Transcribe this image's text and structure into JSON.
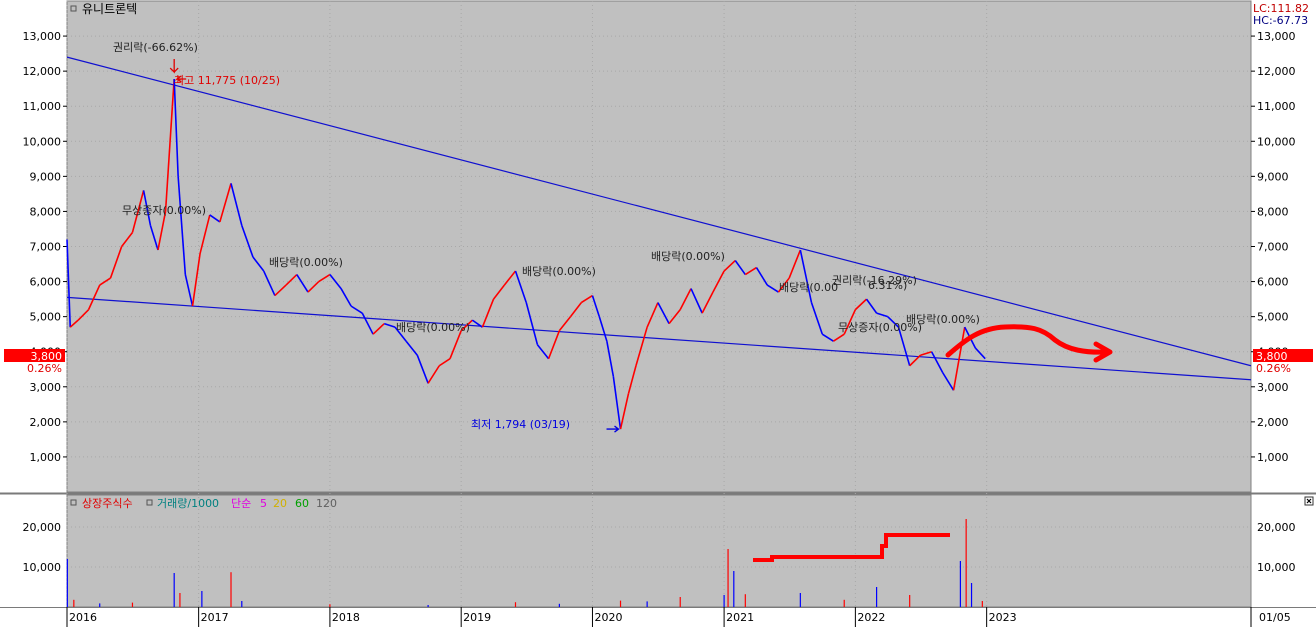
{
  "instrument": {
    "name": "유니트론텍"
  },
  "price_scale": {
    "current_price": "3,800",
    "change_pct": "0.26%",
    "lc_label": "LC:111.82",
    "hc_label": "HC:-67.73"
  },
  "annotations": {
    "high_label": "최고 11,775 (10/25)",
    "low_label": "최저 1,794 (03/19)",
    "rights_ex_1": "권리락(-66.62%)",
    "rights_ex_2": "권리락(-16.29%)",
    "free_issue": "무상증자(0.00%)",
    "dividend": "배당락(0.00%)",
    "partial_1": "배당락(0.00",
    "partial_2": "6.31%)",
    "partial_3": "무상증자(0.00%)"
  },
  "volume_legend": {
    "listed_shares": "상장주식수",
    "volume": "거래량/1000",
    "simple": "단순",
    "ma5": "5",
    "ma20": "20",
    "ma60": "60",
    "ma120": "120"
  },
  "date_axis": {
    "end_label": "01/05"
  },
  "colors": {
    "panel_bg": "#c0c0c0",
    "up": "#ff0000",
    "down": "#0000ff",
    "trendline": "#1010d0",
    "price_badge": "#ff0000"
  },
  "chart_data": {
    "type": "line",
    "title": "유니트론텍",
    "x_axis": {
      "type": "date",
      "range": [
        "2016-01-01",
        "2025-01-05"
      ],
      "ticks": [
        "2016",
        "2017",
        "2018",
        "2019",
        "2020",
        "2021",
        "2022",
        "2023"
      ]
    },
    "y_axis": {
      "range": [
        0,
        14000
      ],
      "ticks": [
        "1,000",
        "2,000",
        "3,000",
        "4,000",
        "5,000",
        "6,000",
        "7,000",
        "8,000",
        "9,000",
        "10,000",
        "11,000",
        "12,000",
        "13,000"
      ]
    },
    "grid": true,
    "series": [
      {
        "name": "price",
        "points": [
          [
            "2016-01-01",
            7200
          ],
          [
            "2016-01-10",
            4700
          ],
          [
            "2016-02-01",
            4900
          ],
          [
            "2016-03-01",
            5200
          ],
          [
            "2016-04-01",
            5900
          ],
          [
            "2016-05-01",
            6100
          ],
          [
            "2016-06-01",
            7000
          ],
          [
            "2016-07-01",
            7400
          ],
          [
            "2016-08-01",
            8600
          ],
          [
            "2016-08-20",
            7600
          ],
          [
            "2016-09-10",
            6900
          ],
          [
            "2016-10-01",
            8000
          ],
          [
            "2016-10-20",
            11000
          ],
          [
            "2016-10-25",
            11775
          ],
          [
            "2016-11-05",
            9000
          ],
          [
            "2016-11-25",
            6200
          ],
          [
            "2016-12-15",
            5300
          ],
          [
            "2017-01-05",
            6800
          ],
          [
            "2017-02-01",
            7900
          ],
          [
            "2017-03-01",
            7700
          ],
          [
            "2017-04-01",
            8800
          ],
          [
            "2017-05-01",
            7600
          ],
          [
            "2017-06-01",
            6700
          ],
          [
            "2017-07-01",
            6300
          ],
          [
            "2017-08-01",
            5600
          ],
          [
            "2017-09-01",
            5900
          ],
          [
            "2017-10-01",
            6200
          ],
          [
            "2017-11-01",
            5700
          ],
          [
            "2017-12-01",
            6000
          ],
          [
            "2018-01-01",
            6200
          ],
          [
            "2018-02-01",
            5800
          ],
          [
            "2018-03-01",
            5300
          ],
          [
            "2018-04-01",
            5100
          ],
          [
            "2018-05-01",
            4500
          ],
          [
            "2018-06-01",
            4800
          ],
          [
            "2018-07-01",
            4700
          ],
          [
            "2018-08-01",
            4300
          ],
          [
            "2018-09-01",
            3900
          ],
          [
            "2018-10-01",
            3100
          ],
          [
            "2018-11-01",
            3600
          ],
          [
            "2018-12-01",
            3800
          ],
          [
            "2019-01-01",
            4600
          ],
          [
            "2019-02-01",
            4900
          ],
          [
            "2019-03-01",
            4700
          ],
          [
            "2019-04-01",
            5500
          ],
          [
            "2019-05-01",
            5900
          ],
          [
            "2019-06-01",
            6300
          ],
          [
            "2019-07-01",
            5400
          ],
          [
            "2019-08-01",
            4200
          ],
          [
            "2019-09-01",
            3800
          ],
          [
            "2019-10-01",
            4600
          ],
          [
            "2019-11-01",
            5000
          ],
          [
            "2019-12-01",
            5400
          ],
          [
            "2020-01-01",
            5600
          ],
          [
            "2020-01-20",
            5000
          ],
          [
            "2020-02-10",
            4300
          ],
          [
            "2020-02-28",
            3300
          ],
          [
            "2020-03-19",
            1794
          ],
          [
            "2020-04-10",
            2800
          ],
          [
            "2020-05-01",
            3600
          ],
          [
            "2020-06-01",
            4700
          ],
          [
            "2020-07-01",
            5400
          ],
          [
            "2020-08-01",
            4800
          ],
          [
            "2020-09-01",
            5200
          ],
          [
            "2020-10-01",
            5800
          ],
          [
            "2020-11-01",
            5100
          ],
          [
            "2020-12-01",
            5700
          ],
          [
            "2021-01-01",
            6300
          ],
          [
            "2021-02-01",
            6600
          ],
          [
            "2021-03-01",
            6200
          ],
          [
            "2021-04-01",
            6400
          ],
          [
            "2021-05-01",
            5900
          ],
          [
            "2021-06-01",
            5700
          ],
          [
            "2021-07-01",
            6100
          ],
          [
            "2021-08-01",
            6900
          ],
          [
            "2021-09-01",
            5400
          ],
          [
            "2021-10-01",
            4500
          ],
          [
            "2021-11-01",
            4300
          ],
          [
            "2021-12-01",
            4500
          ],
          [
            "2022-01-01",
            5200
          ],
          [
            "2022-02-01",
            5500
          ],
          [
            "2022-03-01",
            5100
          ],
          [
            "2022-04-01",
            5000
          ],
          [
            "2022-05-01",
            4700
          ],
          [
            "2022-06-01",
            3600
          ],
          [
            "2022-07-01",
            3900
          ],
          [
            "2022-08-01",
            4000
          ],
          [
            "2022-09-01",
            3400
          ],
          [
            "2022-10-01",
            2900
          ],
          [
            "2022-11-01",
            4700
          ],
          [
            "2022-12-01",
            4100
          ],
          [
            "2022-12-28",
            3800
          ]
        ]
      },
      {
        "name": "volume",
        "points": [
          [
            "2016-01-02",
            12000
          ],
          [
            "2016-01-20",
            1800
          ],
          [
            "2016-04-01",
            900
          ],
          [
            "2016-07-01",
            1100
          ],
          [
            "2016-10-25",
            8500
          ],
          [
            "2016-11-10",
            3500
          ],
          [
            "2017-01-10",
            4000
          ],
          [
            "2017-04-01",
            8700
          ],
          [
            "2017-05-01",
            1500
          ],
          [
            "2018-01-01",
            700
          ],
          [
            "2018-10-01",
            500
          ],
          [
            "2019-06-01",
            1200
          ],
          [
            "2019-10-01",
            800
          ],
          [
            "2020-03-19",
            1600
          ],
          [
            "2020-06-01",
            1400
          ],
          [
            "2020-09-01",
            2500
          ],
          [
            "2021-01-01",
            3000
          ],
          [
            "2021-01-12",
            14500
          ],
          [
            "2021-01-28",
            9000
          ],
          [
            "2021-03-01",
            3200
          ],
          [
            "2021-08-01",
            3500
          ],
          [
            "2021-12-01",
            1800
          ],
          [
            "2022-03-01",
            5000
          ],
          [
            "2022-06-01",
            3000
          ],
          [
            "2022-10-20",
            11500
          ],
          [
            "2022-11-05",
            22000
          ],
          [
            "2022-11-20",
            6000
          ],
          [
            "2022-12-20",
            1500
          ]
        ]
      }
    ],
    "volume_axis": {
      "range": [
        0,
        28000
      ],
      "ticks": [
        "10,000",
        "20,000"
      ]
    },
    "trendlines": [
      {
        "from": [
          "2016-01-01",
          12400
        ],
        "to": [
          "2025-01-05",
          3600
        ]
      },
      {
        "from": [
          "2016-01-01",
          5550
        ],
        "to": [
          "2025-01-05",
          3200
        ]
      }
    ],
    "markers": {
      "high": {
        "date": "2016-10-25",
        "value": 11775
      },
      "low": {
        "date": "2020-03-19",
        "value": 1794
      }
    }
  }
}
